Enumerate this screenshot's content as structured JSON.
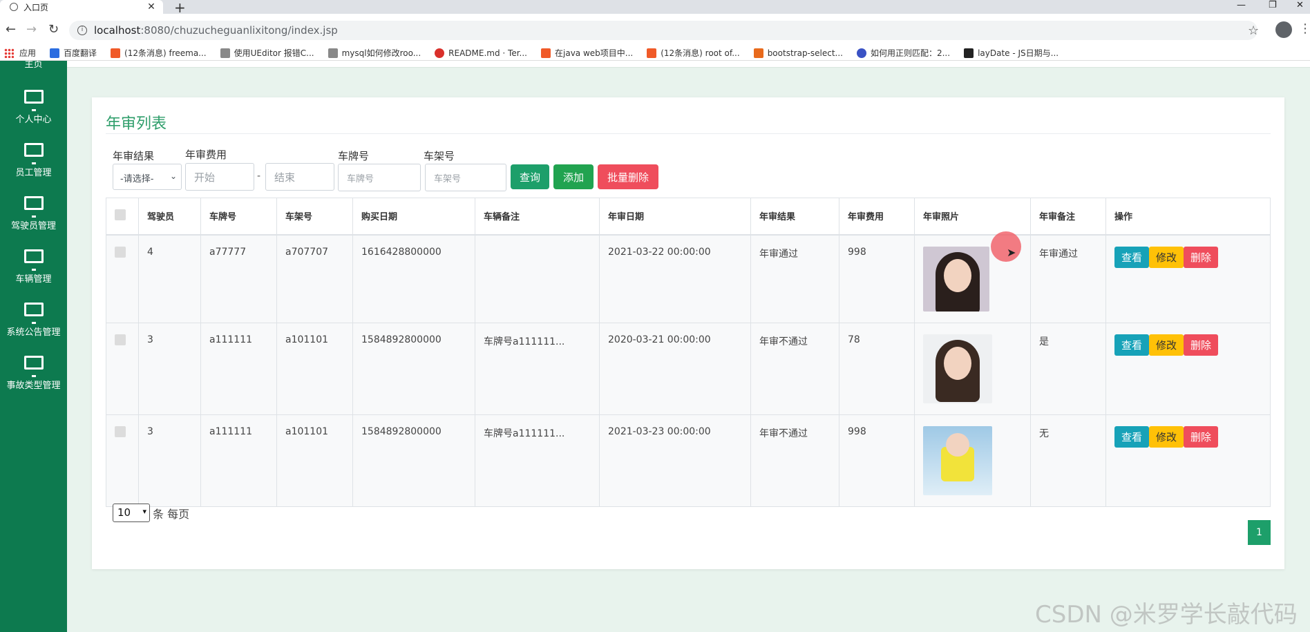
{
  "browser": {
    "tab_title": "入口页",
    "url_host": "localhost",
    "url_path": ":8080/chuzucheguanlixitong/index.jsp",
    "bookmarks": [
      {
        "label": "应用",
        "color": "#e53935"
      },
      {
        "label": "百度翻译",
        "color": "#2b6de0"
      },
      {
        "label": "(12条消息) freema...",
        "color": "#f05a28"
      },
      {
        "label": "使用UEditor 报错C...",
        "color": "#555555"
      },
      {
        "label": "mysql如何修改roo...",
        "color": "#555555"
      },
      {
        "label": "README.md · Ter...",
        "color": "#d9302b"
      },
      {
        "label": "在java web项目中...",
        "color": "#f05a28"
      },
      {
        "label": "(12条消息) root of...",
        "color": "#f05a28"
      },
      {
        "label": "bootstrap-select...",
        "color": "#e86a1c"
      },
      {
        "label": "如何用正则匹配：2...",
        "color": "#3a52c4"
      },
      {
        "label": "layDate - JS日期与...",
        "color": "#222222"
      }
    ]
  },
  "sidebar": {
    "top_partial": "主页",
    "items": [
      {
        "label": "个人中心"
      },
      {
        "label": "员工管理"
      },
      {
        "label": "驾驶员管理"
      },
      {
        "label": "车辆管理"
      },
      {
        "label": "系统公告管理"
      },
      {
        "label": "事故类型管理"
      }
    ]
  },
  "page": {
    "title": "年审列表",
    "filters": {
      "result_label": "年审结果",
      "result_select": "-请选择-",
      "fee_label": "年审费用",
      "fee_start_placeholder": "开始",
      "fee_separator": "-",
      "fee_end_placeholder": "结束",
      "plate_label": "车牌号",
      "plate_placeholder": "车牌号",
      "frame_label": "车架号",
      "frame_placeholder": "车架号"
    },
    "buttons": {
      "query": "查询",
      "add": "添加",
      "batch_delete": "批量删除"
    },
    "table": {
      "headers": [
        "驾驶员",
        "车牌号",
        "车架号",
        "购买日期",
        "车辆备注",
        "年审日期",
        "年审结果",
        "年审费用",
        "年审照片",
        "年审备注",
        "操作"
      ],
      "rows": [
        {
          "driver": "4",
          "plate": "a77777",
          "frame": "a707707",
          "purchase": "1616428800000",
          "remark": "",
          "date": "2021-03-22 00:00:00",
          "result": "年审通过",
          "fee": "998",
          "note": "年审通过"
        },
        {
          "driver": "3",
          "plate": "a111111",
          "frame": "a101101",
          "purchase": "1584892800000",
          "remark": "车牌号a111111...",
          "date": "2020-03-21 00:00:00",
          "result": "年审不通过",
          "fee": "78",
          "note": "是"
        },
        {
          "driver": "3",
          "plate": "a111111",
          "frame": "a101101",
          "purchase": "1584892800000",
          "remark": "车牌号a111111...",
          "date": "2021-03-23 00:00:00",
          "result": "年审不通过",
          "fee": "998",
          "note": "无"
        }
      ],
      "actions": {
        "view": "查看",
        "edit": "修改",
        "delete": "删除"
      }
    },
    "pagination": {
      "page_size": "10",
      "per_page_text": "条 每页",
      "current_page": "1"
    }
  },
  "watermark": "CSDN @米罗学长敲代码",
  "colors": {
    "sidebar": "#0d7a4f",
    "accent": "#1d9f6a",
    "danger": "#ef4d5c",
    "warning": "#ffc107",
    "info": "#17a2b8"
  }
}
